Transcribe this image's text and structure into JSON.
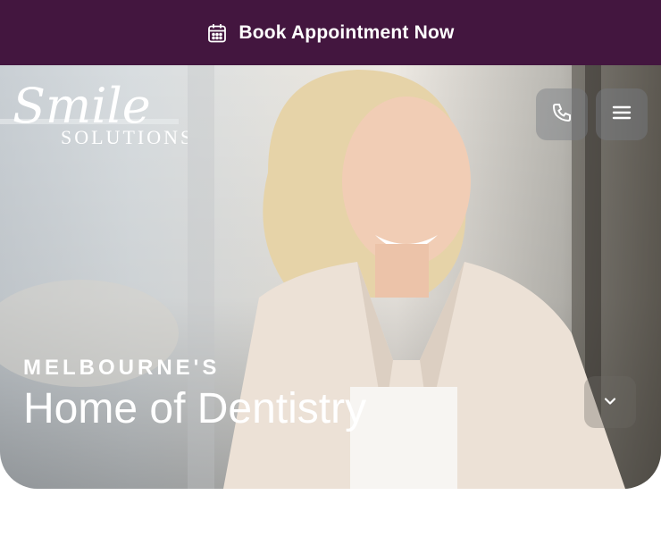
{
  "announcement": {
    "label": "Book Appointment Now",
    "icon": "calendar-icon"
  },
  "brand": {
    "logo_text_script": "Smile",
    "logo_text_caps": "SOLUTIONS"
  },
  "header": {
    "phone_icon": "phone-icon",
    "menu_icon": "hamburger-menu-icon"
  },
  "hero": {
    "eyebrow": "MELBOURNE'S",
    "headline": "Home of Dentistry",
    "scroll_icon": "chevron-down-icon"
  },
  "colors": {
    "brand_purple": "#43163f",
    "white": "#ffffff"
  }
}
